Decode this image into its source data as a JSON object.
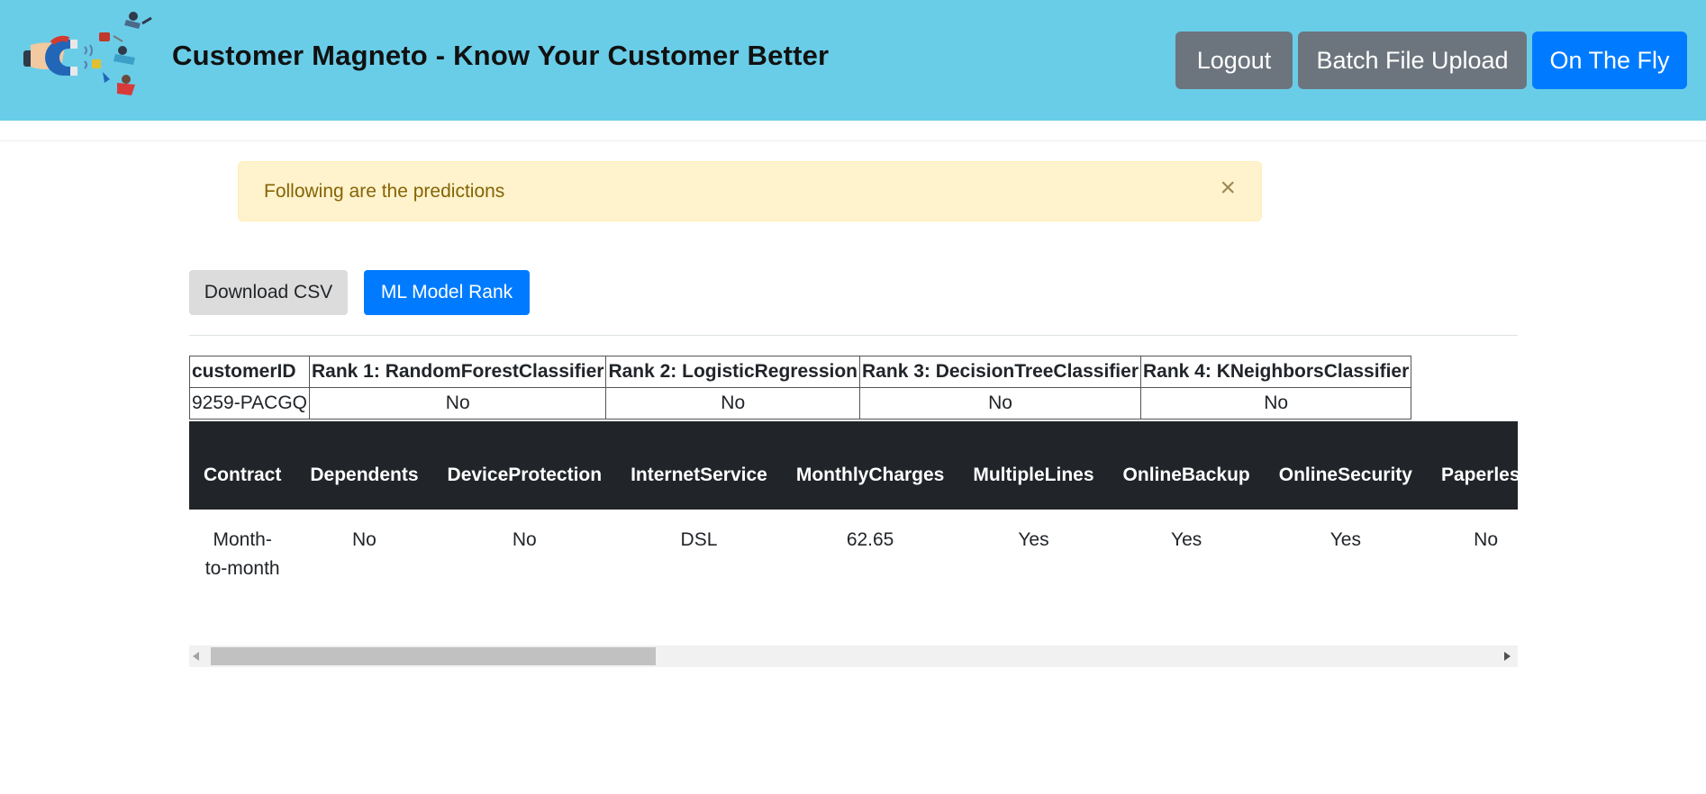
{
  "header": {
    "brand": "Customer Magneto - Know Your Customer Better",
    "logout_label": "Logout",
    "batch_label": "Batch File Upload",
    "fly_label": "On The Fly",
    "bg_color": "#69cde8"
  },
  "alert": {
    "message": "Following are the predictions",
    "close_glyph": "×",
    "bg_color": "#fff3cd"
  },
  "actions": {
    "download_label": "Download CSV",
    "rank_label": "ML Model Rank"
  },
  "rank_table": {
    "headers": [
      "customerID",
      "Rank 1: RandomForestClassifier",
      "Rank 2: LogisticRegression",
      "Rank 3: DecisionTreeClassifier",
      "Rank 4: KNeighborsClassifier"
    ],
    "row": [
      "9259-PACGQ",
      "No",
      "No",
      "No",
      "No"
    ]
  },
  "data_table": {
    "headers": [
      "Contract",
      "Dependents",
      "DeviceProtection",
      "InternetService",
      "MonthlyCharges",
      "MultipleLines",
      "OnlineBackup",
      "OnlineSecurity",
      "Paperless"
    ],
    "row": [
      "Month-to-month",
      "No",
      "No",
      "DSL",
      "62.65",
      "Yes",
      "Yes",
      "Yes",
      "No"
    ]
  },
  "scrollbar": {
    "position_fraction": 0.0
  }
}
